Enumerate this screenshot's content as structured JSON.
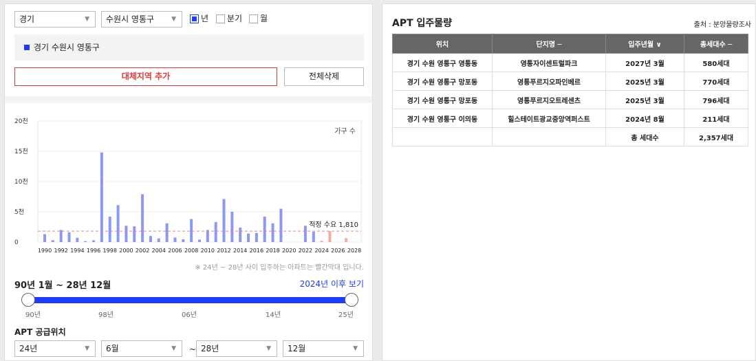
{
  "filters": {
    "province": "경기",
    "city": "수원시 영통구",
    "period_options": [
      {
        "label": "년",
        "checked": true
      },
      {
        "label": "분기",
        "checked": false
      },
      {
        "label": "월",
        "checked": false
      }
    ]
  },
  "region": {
    "selected": "경기 수원시 영통구"
  },
  "buttons": {
    "add_region": "대체지역 추가",
    "delete_all": "전체삭제"
  },
  "chart_data": {
    "type": "bar",
    "legend_label": "가구 수",
    "y_ticks": [
      "0",
      "5천",
      "10천",
      "15천",
      "20천"
    ],
    "ylim": [
      0,
      20000
    ],
    "x_tick_labels": [
      "1990",
      "1992",
      "1994",
      "1996",
      "1998",
      "2000",
      "2002",
      "2004",
      "2006",
      "2008",
      "2010",
      "2012",
      "2014",
      "2016",
      "2018",
      "2020",
      "2022",
      "2024",
      "2026",
      "2028"
    ],
    "years": [
      1990,
      1991,
      1992,
      1993,
      1994,
      1995,
      1996,
      1997,
      1998,
      1999,
      2000,
      2001,
      2002,
      2003,
      2004,
      2005,
      2006,
      2007,
      2008,
      2009,
      2010,
      2011,
      2012,
      2013,
      2014,
      2015,
      2016,
      2017,
      2018,
      2019,
      2020,
      2021,
      2022,
      2023,
      2024,
      2025,
      2026,
      2027,
      2028
    ],
    "values": [
      1300,
      300,
      2000,
      1600,
      700,
      150,
      300,
      14800,
      4200,
      6100,
      2700,
      2600,
      7900,
      1000,
      600,
      3100,
      750,
      450,
      3800,
      400,
      2000,
      3300,
      7100,
      5000,
      2400,
      1400,
      1500,
      4200,
      3100,
      5500,
      0,
      0,
      2700,
      1700,
      200,
      1800,
      0,
      650,
      0
    ],
    "highlight_from": 2024,
    "base_color": "#8d99f0",
    "highlight_color": "#f4aaa6",
    "reference_line": {
      "value": 1810,
      "label": "적정 수요 1,810",
      "color": "#f08080"
    }
  },
  "note": "※ 24년 ~ 28년 사이 입주하는 아파트는 빨간막대 입니다.",
  "range": {
    "title": "90년 1월 ~ 28년 12월",
    "link": "2024년 이후 보기",
    "labels": [
      "90년",
      "98년",
      "06년",
      "14년",
      "25년"
    ]
  },
  "supply": {
    "title": "APT 공급위치",
    "from_year": "24년",
    "from_month": "6월",
    "tilde": "~",
    "to_year": "28년",
    "to_month": "12월"
  },
  "right": {
    "title": "APT 입주물량",
    "source": "출처 : 분양물량조사",
    "headers": [
      "위치",
      "단지명 ─",
      "입주년월 ∨",
      "총세대수 ─"
    ],
    "rows": [
      [
        "경기 수원 영통구 영통동",
        "영통자이센트럴파크",
        "2027년 3월",
        "580세대"
      ],
      [
        "경기 수원 영통구 망포동",
        "영통푸르지오파인베르",
        "2025년 3월",
        "770세대"
      ],
      [
        "경기 수원 영통구 망포동",
        "영통푸르지오트레센츠",
        "2025년 3월",
        "796세대"
      ],
      [
        "경기 수원 영통구 이의동",
        "힐스테이트광교중앙역퍼스트",
        "2024년 8월",
        "211세대"
      ]
    ],
    "total_label": "총 세대수",
    "total_value": "2,357세대"
  }
}
